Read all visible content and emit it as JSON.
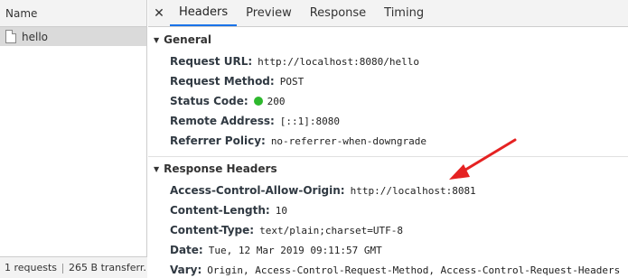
{
  "left": {
    "column_header": "Name",
    "requests": [
      {
        "name": "hello"
      }
    ],
    "status": {
      "requests": "1 requests",
      "transferred": "265 B transferr..."
    }
  },
  "tabs": [
    "Headers",
    "Preview",
    "Response",
    "Timing"
  ],
  "active_tab": "Headers",
  "general": {
    "title": "General",
    "rows": [
      {
        "key": "Request URL:",
        "value": "http://localhost:8080/hello"
      },
      {
        "key": "Request Method:",
        "value": "POST"
      },
      {
        "key": "Status Code:",
        "value": "200"
      },
      {
        "key": "Remote Address:",
        "value": "[::1]:8080"
      },
      {
        "key": "Referrer Policy:",
        "value": "no-referrer-when-downgrade"
      }
    ]
  },
  "response_headers": {
    "title": "Response Headers",
    "rows": [
      {
        "key": "Access-Control-Allow-Origin:",
        "value": "http://localhost:8081"
      },
      {
        "key": "Content-Length:",
        "value": "10"
      },
      {
        "key": "Content-Type:",
        "value": "text/plain;charset=UTF-8"
      },
      {
        "key": "Date:",
        "value": "Tue, 12 Mar 2019 09:11:57 GMT"
      },
      {
        "key": "Vary:",
        "value": "Origin, Access-Control-Request-Method, Access-Control-Request-Headers"
      }
    ]
  },
  "colors": {
    "status_dot": "#2eb82e",
    "arrow": "#e52222",
    "active_tab_underline": "#1a73e8"
  }
}
